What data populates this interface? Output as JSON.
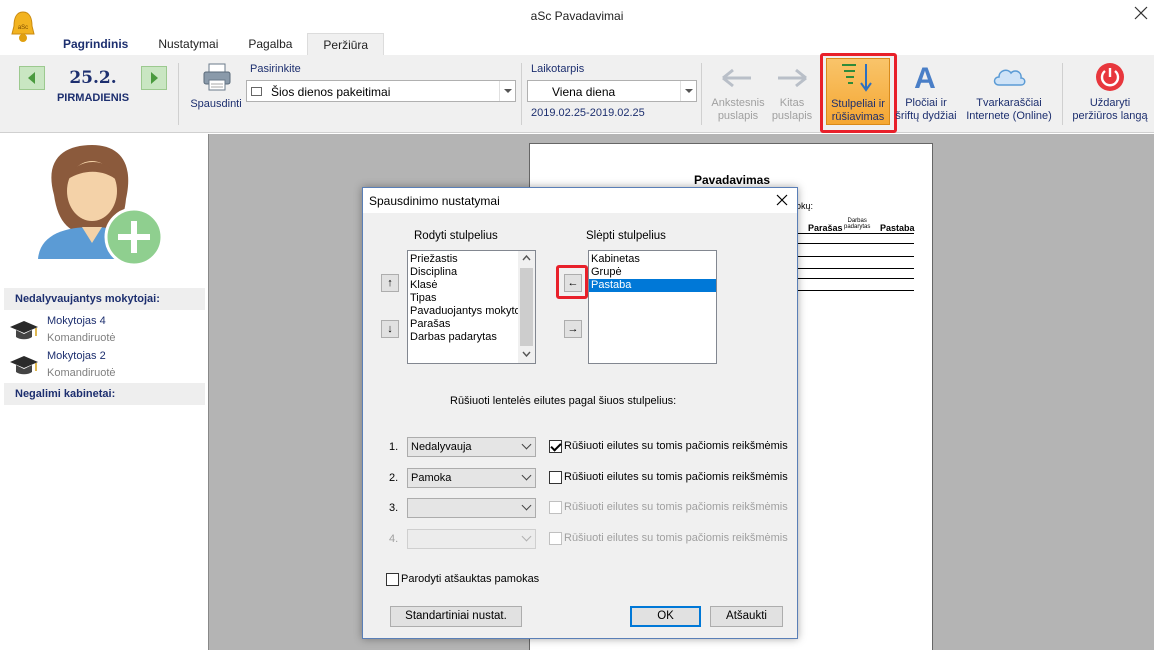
{
  "app": {
    "title": "aSc Pavadavimai"
  },
  "tabs": [
    "Pagrindinis",
    "Nustatymai",
    "Pagalba",
    "Peržiūra"
  ],
  "ribbon": {
    "date": "25.2.",
    "day": "PIRMADIENIS",
    "print_label": "Spausdinti",
    "choose_caption": "Pasirinkite",
    "choose_value": "Šios dienos pakeitimai",
    "period_caption": "Laikotarpis",
    "period_value": "Viena diena",
    "period_range": "2019.02.25-2019.02.25",
    "prev_page_l1": "Ankstesnis",
    "prev_page_l2": "puslapis",
    "next_page_l1": "Kitas",
    "next_page_l2": "puslapis",
    "columns_l1": "Stulpeliai ir",
    "columns_l2": "rūšiavimas",
    "fonts_l1": "Pločiai ir",
    "fonts_l2": "šriftų dydžiai",
    "online_l1": "Tvarkaraščiai",
    "online_l2": "Internete (Online)",
    "close_l1": "Uždaryti",
    "close_l2": "peržiūros langą",
    "accent": "#f5a733",
    "highlight": "#e8202a"
  },
  "left": {
    "absent_header": "Nedalyvaujantys mokytojai:",
    "teachers": [
      {
        "name": "Mokytojas 4",
        "status": "Komandiruotė"
      },
      {
        "name": "Mokytojas 2",
        "status": "Komandiruotė"
      }
    ],
    "rooms_header": "Negalimi kabinetai:"
  },
  "paper": {
    "title": "Pavadavimas",
    "frag_text": "okų:",
    "col_signature": "Parašas",
    "col_work_l1": "Darbas",
    "col_work_l2": "padarytas",
    "col_note": "Pastaba"
  },
  "dialog": {
    "title": "Spausdinimo nustatymai",
    "show_header": "Rodyti stulpelius",
    "hide_header": "Slėpti stulpelius",
    "shown_columns": [
      "Priežastis",
      "Disciplina",
      "Klasė",
      "Tipas",
      "Pavaduojantys mokytojai",
      "Parašas",
      "Darbas padarytas"
    ],
    "hidden_columns": [
      "Kabinetas",
      "Grupė",
      "Pastaba"
    ],
    "selected_hidden_index": 2,
    "sort_header": "Rūšiuoti lentelės eilutes pagal šiuos stulpelius:",
    "sort_rows": [
      {
        "num": "1.",
        "value": "Nedalyvauja",
        "checked": true,
        "enabled": true,
        "label": "Rūšiuoti eilutes su tomis pačiomis reikšmėmis"
      },
      {
        "num": "2.",
        "value": "Pamoka",
        "checked": false,
        "enabled": true,
        "label": "Rūšiuoti eilutes su tomis pačiomis reikšmėmis"
      },
      {
        "num": "3.",
        "value": "",
        "checked": false,
        "enabled": true,
        "label": "Rūšiuoti eilutes su tomis pačiomis reikšmėmis"
      },
      {
        "num": "4.",
        "value": "",
        "checked": false,
        "enabled": false,
        "label": "Rūšiuoti eilutes su tomis pačiomis reikšmėmis"
      }
    ],
    "show_cancelled_label": "Parodyti atšauktas pamokas",
    "defaults_button": "Standartiniai nustat.",
    "ok_button": "OK",
    "cancel_button": "Atšaukti"
  }
}
